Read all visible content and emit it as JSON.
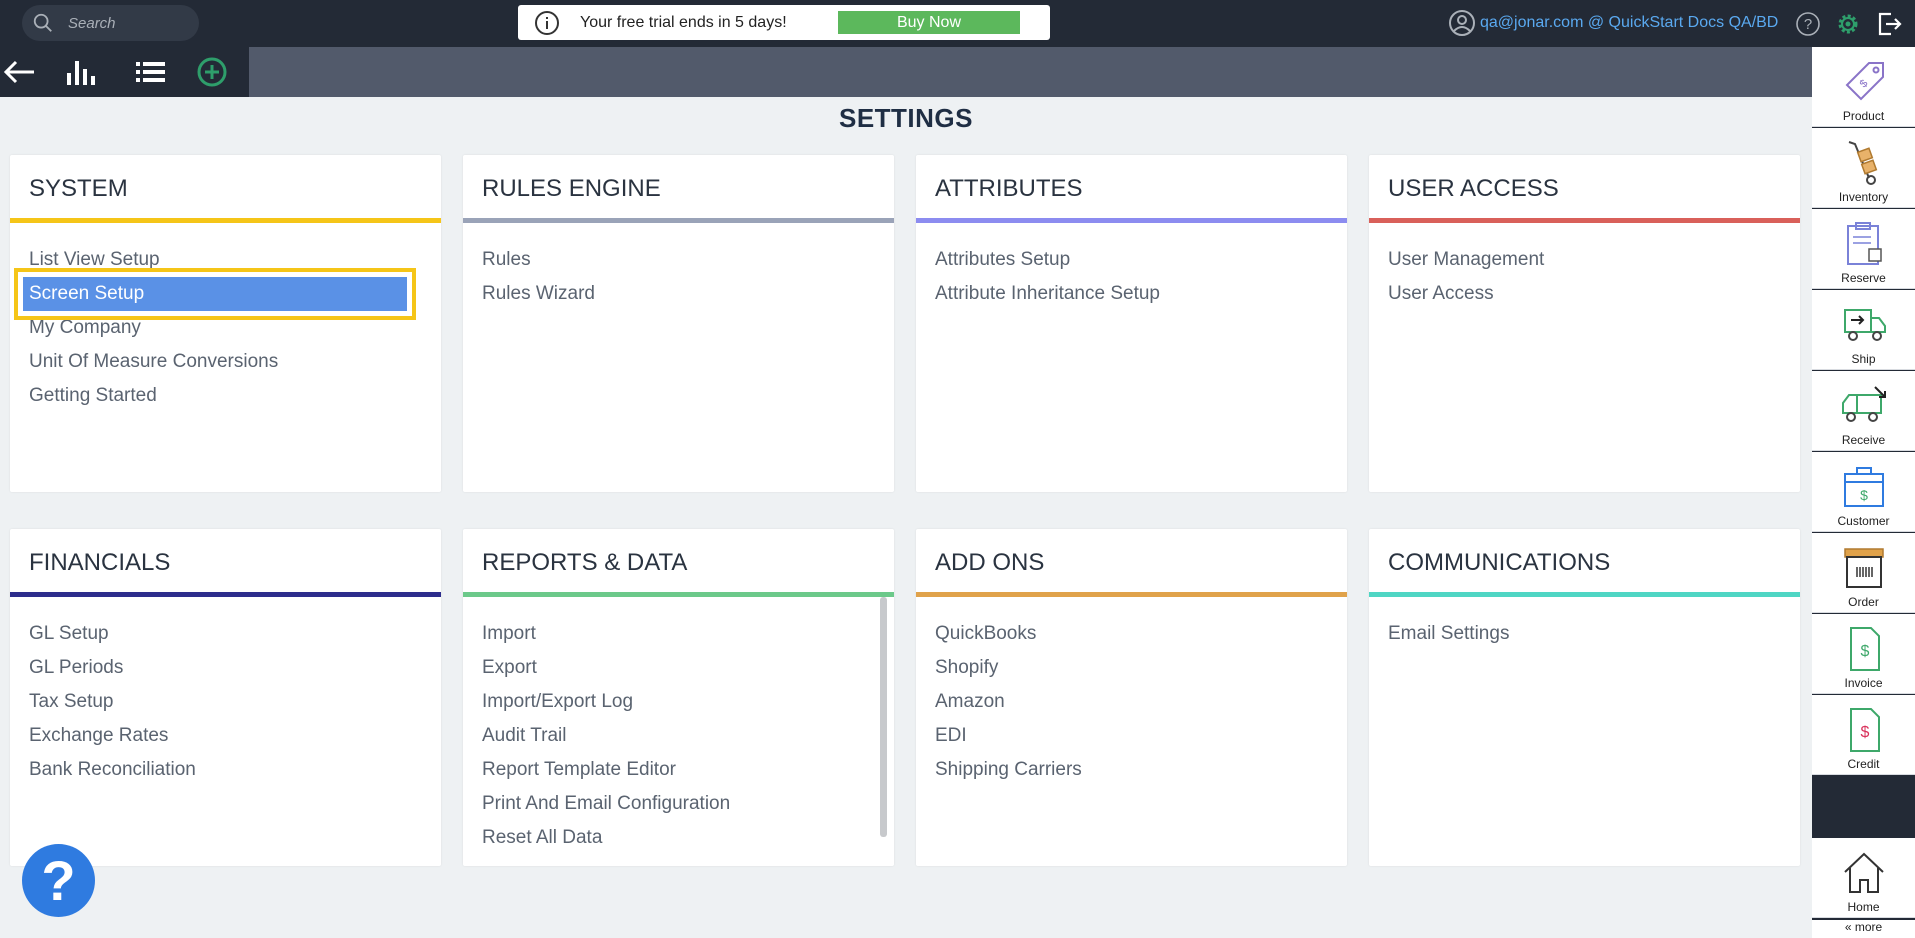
{
  "search": {
    "placeholder": "Search"
  },
  "trial": {
    "message": "Your free trial ends in 5 days!",
    "button": "Buy Now"
  },
  "user": {
    "label": "qa@jonar.com @ QuickStart Docs QA/BD"
  },
  "page_title": "SETTINGS",
  "cards": [
    {
      "title": "SYSTEM",
      "color": "#f5c518",
      "items": [
        "List View Setup",
        "Screen Setup",
        "My Company",
        "Unit Of Measure Conversions",
        "Getting Started"
      ]
    },
    {
      "title": "RULES ENGINE",
      "color": "#9aa3b8",
      "items": [
        "Rules",
        "Rules Wizard"
      ]
    },
    {
      "title": "ATTRIBUTES",
      "color": "#8c8cf0",
      "items": [
        "Attributes Setup",
        "Attribute Inheritance Setup"
      ]
    },
    {
      "title": "USER ACCESS",
      "color": "#d9605a",
      "items": [
        "User Management",
        "User Access"
      ]
    },
    {
      "title": "FINANCIALS",
      "color": "#2d2d8c",
      "items": [
        "GL Setup",
        "GL Periods",
        "Tax Setup",
        "Exchange Rates",
        "Bank Reconciliation"
      ]
    },
    {
      "title": "REPORTS & DATA",
      "color": "#6cc98a",
      "items": [
        "Import",
        "Export",
        "Import/Export Log",
        "Audit Trail",
        "Report Template Editor",
        "Print And Email Configuration",
        "Reset All Data"
      ]
    },
    {
      "title": "ADD ONS",
      "color": "#e0a24a",
      "items": [
        "QuickBooks",
        "Shopify",
        "Amazon",
        "EDI",
        "Shipping Carriers"
      ]
    },
    {
      "title": "COMMUNICATIONS",
      "color": "#4fd6c4",
      "items": [
        "Email Settings"
      ]
    }
  ],
  "selected_item": "Screen Setup",
  "rail": [
    {
      "label": "Product",
      "icon": "tag-icon"
    },
    {
      "label": "Inventory",
      "icon": "hand-truck-icon"
    },
    {
      "label": "Reserve",
      "icon": "clipboard-box-icon"
    },
    {
      "label": "Ship",
      "icon": "truck-out-icon"
    },
    {
      "label": "Receive",
      "icon": "truck-in-icon"
    },
    {
      "label": "Customer",
      "icon": "briefcase-dollar-icon"
    },
    {
      "label": "Order",
      "icon": "box-barcode-icon"
    },
    {
      "label": "Invoice",
      "icon": "invoice-dollar-icon"
    },
    {
      "label": "Credit",
      "icon": "credit-doc-icon"
    },
    {
      "label": "Home",
      "icon": "home-icon"
    }
  ],
  "more_label": "« more",
  "fab_label": "?"
}
